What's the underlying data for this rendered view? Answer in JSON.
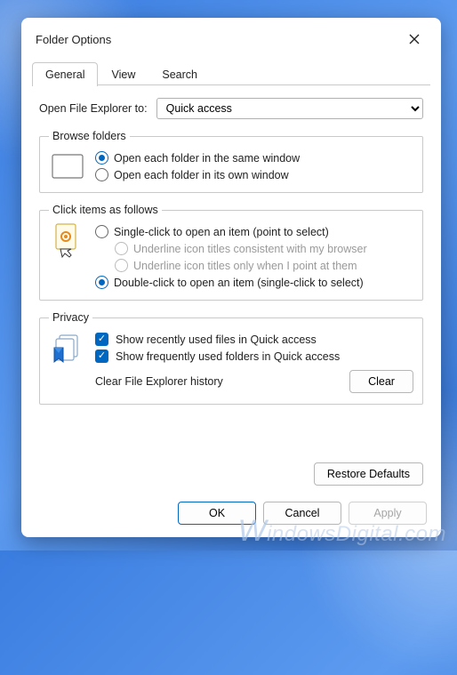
{
  "title": "Folder Options",
  "tabs": {
    "general": "General",
    "view": "View",
    "search": "Search"
  },
  "open_label": "Open File Explorer to:",
  "open_value": "Quick access",
  "group_browse": {
    "legend": "Browse folders",
    "opt_same": "Open each folder in the same window",
    "opt_own": "Open each folder in its own window"
  },
  "group_click": {
    "legend": "Click items as follows",
    "single": "Single-click to open an item (point to select)",
    "ul_browser": "Underline icon titles consistent with my browser",
    "ul_point": "Underline icon titles only when I point at them",
    "double": "Double-click to open an item (single-click to select)"
  },
  "group_privacy": {
    "legend": "Privacy",
    "recent_files": "Show recently used files in Quick access",
    "freq_folders": "Show frequently used folders in Quick access",
    "clear_label": "Clear File Explorer history",
    "clear_btn": "Clear"
  },
  "restore_btn": "Restore Defaults",
  "buttons": {
    "ok": "OK",
    "cancel": "Cancel",
    "apply": "Apply"
  },
  "watermark": {
    "w": "W",
    "rest": "indowsDigital.com"
  }
}
